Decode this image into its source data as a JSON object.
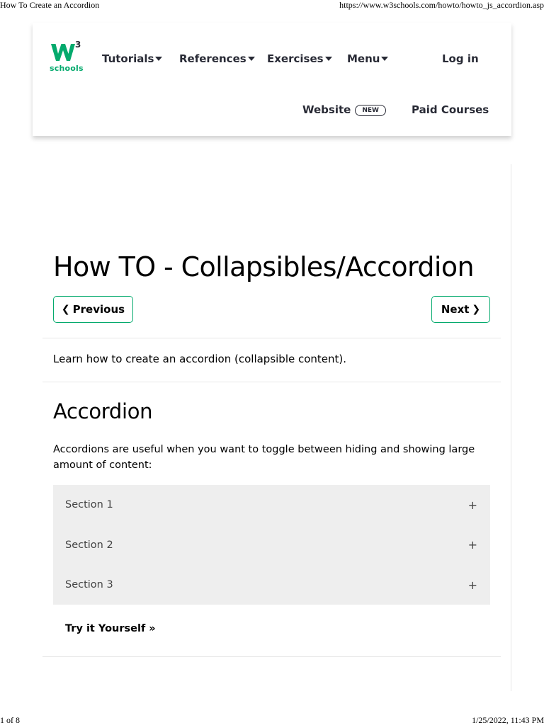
{
  "print_header": {
    "title": "How To Create an Accordion",
    "url": "https://www.w3schools.com/howto/howto_js_accordion.asp"
  },
  "print_footer": {
    "page": "1 of 8",
    "datetime": "1/25/2022, 11:43 PM"
  },
  "logo": {
    "text": "schools",
    "superscript": "3",
    "brand_color": "#04aa6d"
  },
  "nav": {
    "tutorials": "Tutorials",
    "references": "References",
    "exercises": "Exercises",
    "menu": "Menu",
    "login": "Log in",
    "website": "Website",
    "new_badge": "NEW",
    "paid_courses": "Paid Courses"
  },
  "page": {
    "title": "How TO - Collapsibles/Accordion",
    "prev_label": "Previous",
    "next_label": "Next",
    "intro": "Learn how to create an accordion (collapsible content).",
    "section_title": "Accordion",
    "section_text": "Accordions are useful when you want to toggle between hiding and showing large amount of content:",
    "try_it": "Try it Yourself »"
  },
  "accordion": {
    "items": [
      {
        "label": "Section 1",
        "toggle": "+"
      },
      {
        "label": "Section 2",
        "toggle": "+"
      },
      {
        "label": "Section 3",
        "toggle": "+"
      }
    ]
  },
  "icons": {
    "prev": "chevron-left-icon",
    "next": "chevron-right-icon",
    "dropdown": "caret-down-icon"
  }
}
